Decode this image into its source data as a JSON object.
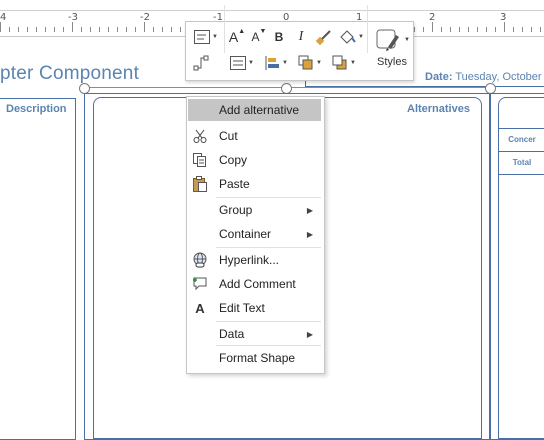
{
  "ruler": {
    "numbers": [
      "4",
      "-3",
      "-2",
      "-1",
      "0",
      "1",
      "2",
      "3"
    ]
  },
  "diagram": {
    "title": "pter Component",
    "date_label": "Date:",
    "date_value": "Tuesday, October",
    "description_label": "Description",
    "alternatives_label": "Alternatives",
    "mini_table": [
      "Concer",
      "Total"
    ]
  },
  "toolbar": {
    "styles_label": "Styles",
    "font_grow": "A",
    "font_shrink": "A",
    "bold": "B",
    "italic": "I"
  },
  "menu": {
    "items": [
      {
        "label": "Add alternative",
        "highlighted": true
      },
      {
        "label": "Cut",
        "icon": "scissors-icon"
      },
      {
        "label": "Copy",
        "icon": "copy-icon"
      },
      {
        "label": "Paste",
        "icon": "clipboard-icon"
      },
      {
        "label": "Group",
        "submenu": true
      },
      {
        "label": "Container",
        "submenu": true
      },
      {
        "label": "Hyperlink...",
        "icon": "hyperlink-icon"
      },
      {
        "label": "Add Comment",
        "icon": "comment-icon"
      },
      {
        "label": "Edit Text",
        "icon": "edit-text-icon"
      },
      {
        "label": "Data",
        "submenu": true
      },
      {
        "label": "Format Shape"
      }
    ]
  },
  "colors": {
    "accent": "#5b84b1",
    "frame": "#4a6fa5",
    "highlight": "#c5c5c5"
  }
}
